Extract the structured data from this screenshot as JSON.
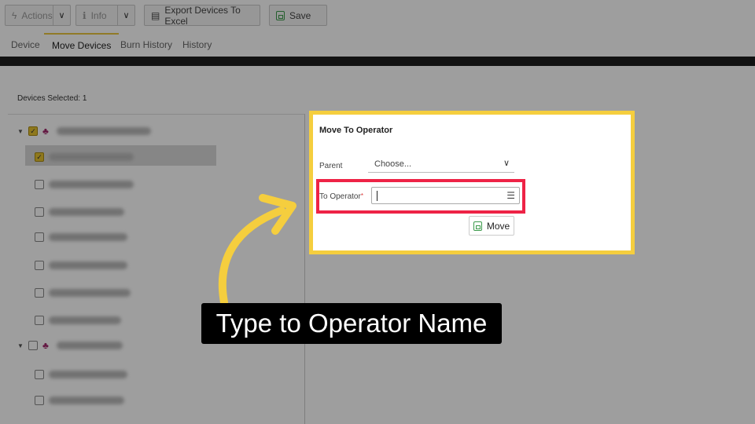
{
  "toolbar": {
    "actions_label": "Actions",
    "info_label": "Info",
    "export_label": "Export Devices To Excel",
    "save_label": "Save"
  },
  "tabs": [
    {
      "label": "Device"
    },
    {
      "label": "Move Devices"
    },
    {
      "label": "Burn History"
    },
    {
      "label": "History"
    }
  ],
  "devices_selected": "Devices Selected: 1",
  "popup": {
    "title": "Move To Operator",
    "parent_label": "Parent",
    "parent_value": "Choose...",
    "to_operator_label": "To Operator",
    "required_mark": "*",
    "move_label": "Move"
  },
  "callout": {
    "text": "Type to Operator Name"
  },
  "colors": {
    "highlight_yellow": "#f5ce3e",
    "highlight_red": "#ee2346",
    "callout_bg": "#000000",
    "arrow": "#f5ce3e"
  }
}
